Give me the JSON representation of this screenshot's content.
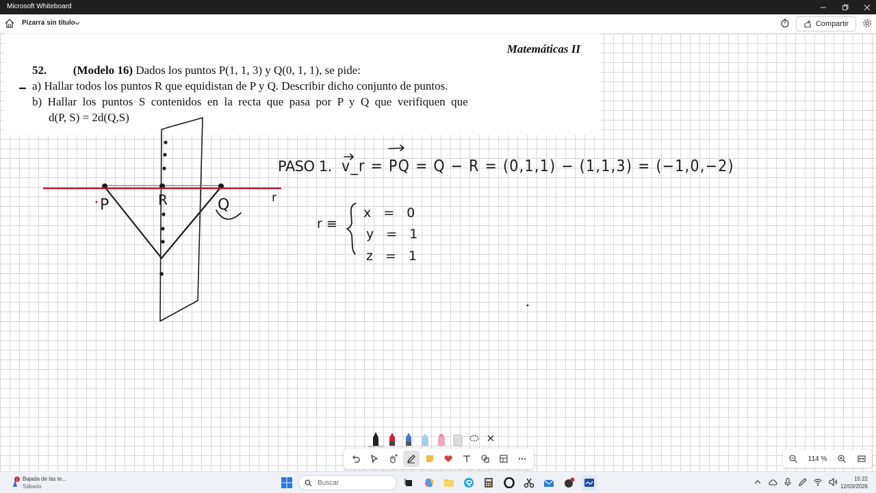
{
  "window": {
    "title": "Microsoft Whiteboard"
  },
  "toolbar": {
    "board_title": "Pizarra sin título",
    "share_label": "Compartir"
  },
  "problem": {
    "subject": "Matemáticas II",
    "number": "52.",
    "model": "(Modelo 16)",
    "statement": "Dados los puntos P(1, 1, 3) y Q(0, 1, 1), se pide:",
    "part_a": "a) Hallar todos los puntos R que equidistan de P y Q. Describir dicho conjunto de puntos.",
    "part_b_1": "b)  Hallar  los  puntos  S  contenidos  en  la  recta  que  pasa  por  P  y  Q  que  verifiquen  que",
    "part_b_2": "d(P, S) = 2d(Q,S)"
  },
  "handwriting": {
    "step": "PASO 1.",
    "vector_eq": "v_r = PQ = Q − R = (0,1,1) − (1,1,3) = (−1,0,−2)",
    "label_p": "P",
    "label_r": "R",
    "label_q": "Q",
    "label_r_line": "r",
    "system_name": "r ≡",
    "system_rows": [
      "x = 0",
      "y = 1",
      "z = 1"
    ]
  },
  "zoom": {
    "level": "114 %"
  },
  "taskbar": {
    "notification_title": "Bajada de las te...",
    "notification_sub": "Sábado",
    "search_placeholder": "Buscar",
    "time": "15:22",
    "date": "12/03/2026",
    "notification_badge": "1"
  },
  "colors": {
    "ink": "#1a1a1a",
    "red_line": "#c8102e",
    "titlebar": "#1f1f1f",
    "grid": "#d6d6d6"
  }
}
